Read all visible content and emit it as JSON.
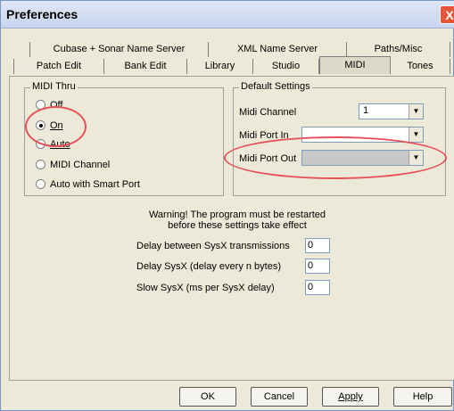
{
  "window": {
    "title": "Preferences",
    "close_label": "X"
  },
  "tabs_back": [
    {
      "label": "Cubase + Sonar Name Server"
    },
    {
      "label": "XML Name Server"
    },
    {
      "label": "Paths/Misc"
    }
  ],
  "tabs_front": [
    {
      "label": "Patch Edit"
    },
    {
      "label": "Bank Edit"
    },
    {
      "label": "Library"
    },
    {
      "label": "Studio"
    },
    {
      "label": "MIDI",
      "active": true
    },
    {
      "label": "Tones"
    }
  ],
  "midi_thru": {
    "label": "MIDI Thru",
    "options": [
      {
        "label": "Off",
        "selected": false
      },
      {
        "label": "On",
        "selected": true
      },
      {
        "label": "Auto",
        "selected": false
      },
      {
        "label": "MIDI Channel",
        "selected": false
      },
      {
        "label": "Auto with Smart Port",
        "selected": false
      }
    ]
  },
  "default_settings": {
    "label": "Default Settings",
    "midi_channel_label": "Midi Channel",
    "midi_channel_value": "1",
    "midi_port_in_label": "Midi Port In",
    "midi_port_in_value": "",
    "midi_port_out_label": "Midi Port Out",
    "midi_port_out_value": ""
  },
  "warning": {
    "line1": "Warning! The program must be restarted",
    "line2": "before these settings take effect"
  },
  "sysx": {
    "delay_label": "Delay between SysX transmissions",
    "delay_value": "0",
    "delay_every_label": "Delay SysX (delay every n bytes)",
    "delay_every_value": "0",
    "slow_label": "Slow SysX (ms per SysX delay)",
    "slow_value": "0"
  },
  "buttons": {
    "ok": "OK",
    "cancel": "Cancel",
    "apply": "Apply",
    "help": "Help"
  },
  "colors": {
    "annotation": "#e8505a",
    "dialog_bg": "#ece9d8",
    "titlebar": "#c7d4ec"
  }
}
